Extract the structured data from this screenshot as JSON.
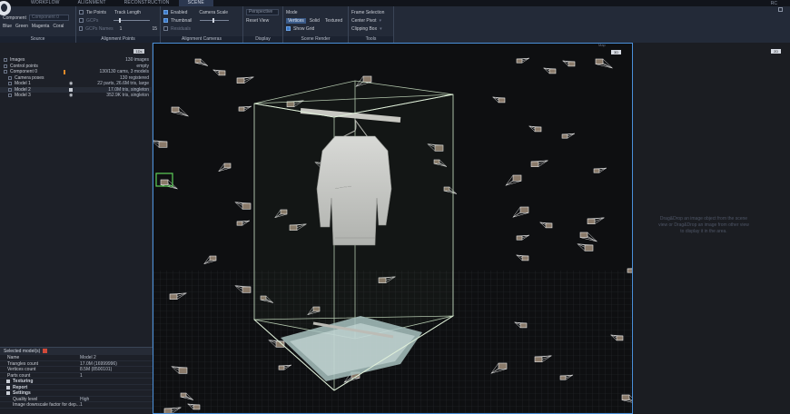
{
  "app_tabs": [
    {
      "label": "WORKFLOW"
    },
    {
      "label": "ALIGNMENT"
    },
    {
      "label": "RECONSTRUCTION"
    },
    {
      "label": "SCENE"
    }
  ],
  "corner_label": "RC",
  "source": {
    "component_label": "Component",
    "component_value": "Component 0",
    "colors": [
      "Blue",
      "Green",
      "Magenta",
      "Coral"
    ],
    "title": "Source"
  },
  "alignment_points": {
    "tie_points": "Tie Points",
    "gcps": "GCPs",
    "gcp_names": "GCPs Names",
    "track_length": "Track Length",
    "track_min": "1",
    "track_max": "15",
    "title": "Alignment Points"
  },
  "alignment_cameras": {
    "enabled": "Enabled",
    "thumbnail": "Thumbnail",
    "residuals": "Residuals",
    "camera_scale": "Camera Scale",
    "title": "Alignment Cameras"
  },
  "display": {
    "projection": "Perspective",
    "reset_view": "Reset View",
    "title": "Display"
  },
  "scene_render": {
    "mode_label": "Mode",
    "modes": [
      "Vertices",
      "Solid",
      "Textured"
    ],
    "show_grid": "Show Grid",
    "title": "Scene Render"
  },
  "tools": {
    "frame_selection": "Frame Selection",
    "center_pivot": "Center Pivot",
    "clipping_box": "Clipping Box",
    "title": "Tools"
  },
  "tree": {
    "header_button": "1Ds",
    "rows": [
      {
        "name": "Images",
        "value": "130 images"
      },
      {
        "name": "Control points",
        "value": "empty"
      },
      {
        "name": "Component 0",
        "value": "130/130 cams, 3 models"
      },
      {
        "name": "Camera poses",
        "value": "130 registered"
      },
      {
        "name": "Model 1",
        "value": "22 parts, 26.6M tris, large"
      },
      {
        "name": "Model 2",
        "value": "17.0M tris, singleton"
      },
      {
        "name": "Model 3",
        "value": "352.9K tris, singleton"
      }
    ]
  },
  "properties": {
    "header": "Selected model(s)",
    "rows": [
      {
        "name": "Name",
        "value": "Model 2"
      },
      {
        "name": "Triangles count",
        "value": "17.0M (16999996)"
      },
      {
        "name": "Vertices count",
        "value": "8.5M (8500101)"
      },
      {
        "name": "Parts count",
        "value": "1"
      }
    ],
    "sections": [
      "Texturing",
      "Report",
      "Settings"
    ],
    "settings_rows": [
      {
        "name": "Quality level",
        "value": "High"
      },
      {
        "name": "Image downscale factor for dep...",
        "value": "1"
      }
    ]
  },
  "viewport": {
    "tag_3d": "3D",
    "tag_map": "Map"
  },
  "panel_2d": {
    "tag": "2D",
    "hint": "Drag&Drop an image object from the scene view or Drag&Drop an image from other view to display it in the area."
  },
  "colors": {
    "accent": "#4a8fd8",
    "box_edge": "#cfe6c8",
    "selected_camera": "#5fd05a"
  }
}
